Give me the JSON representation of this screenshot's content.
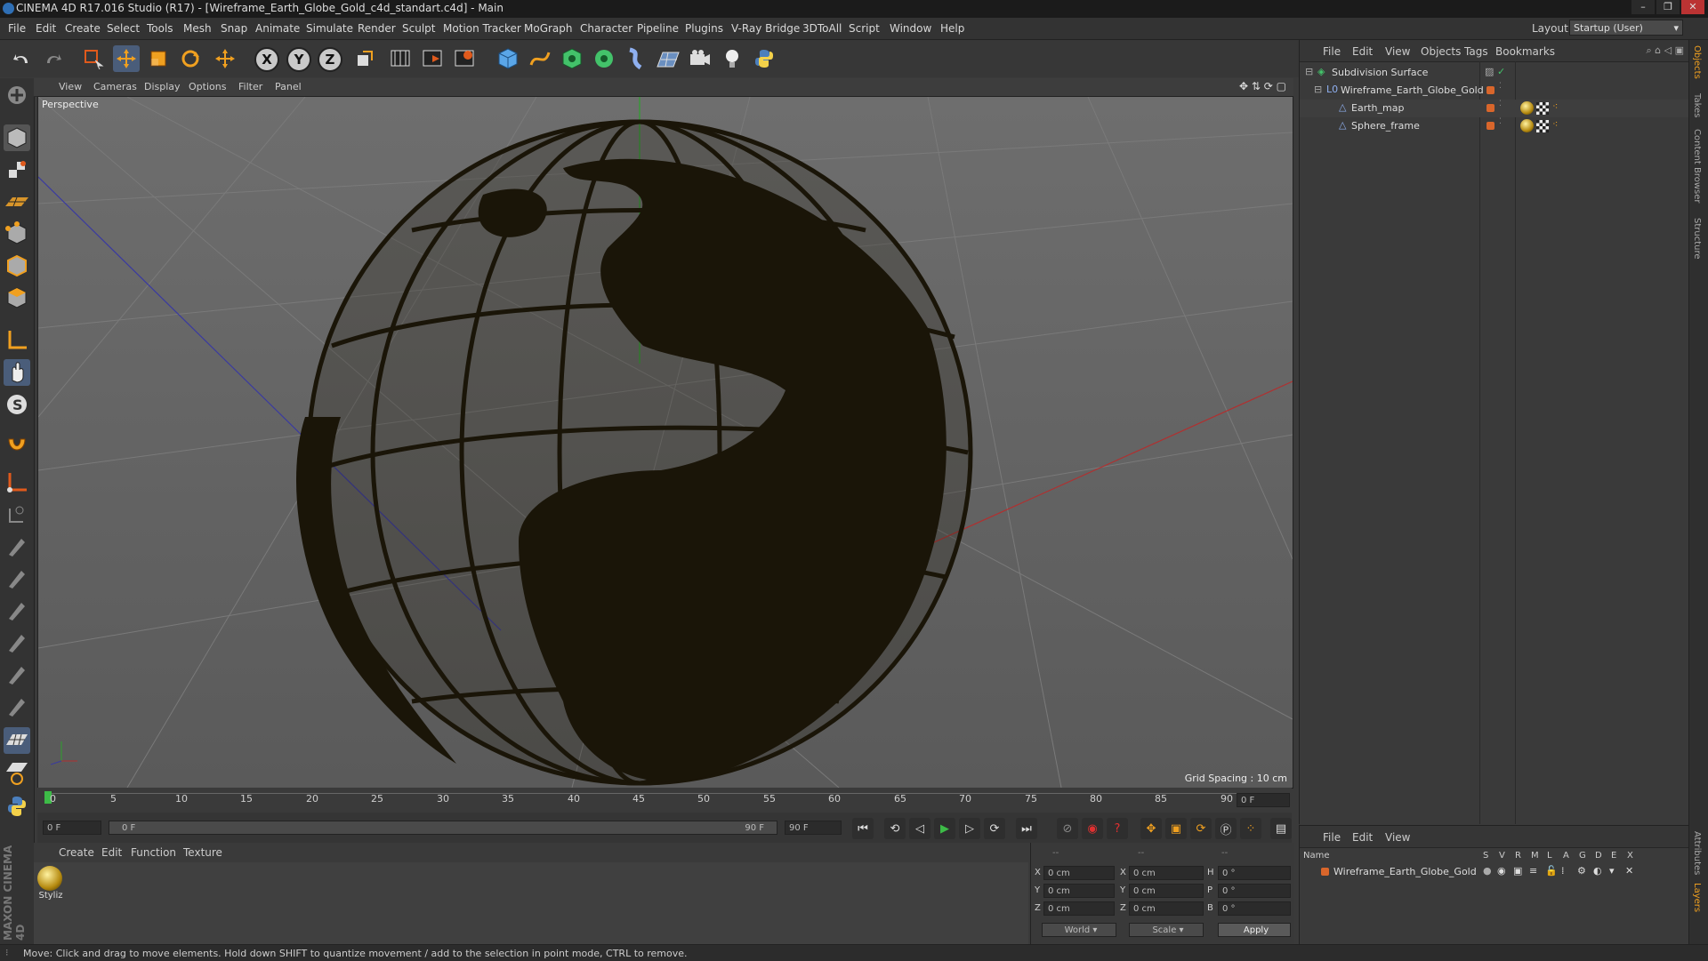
{
  "window": {
    "title": "CINEMA 4D R17.016 Studio (R17) - [Wireframe_Earth_Globe_Gold_c4d_standart.c4d] - Main"
  },
  "menu": [
    "File",
    "Edit",
    "Create",
    "Select",
    "Tools",
    "Mesh",
    "Snap",
    "Animate",
    "Simulate",
    "Render",
    "Sculpt",
    "Motion Tracker",
    "MoGraph",
    "Character",
    "Pipeline",
    "Plugins",
    "V-Ray Bridge",
    "3DToAll",
    "Script",
    "Window",
    "Help"
  ],
  "layout": {
    "label": "Layout:",
    "value": "Startup (User)"
  },
  "toolbar": {
    "axis_x": "X",
    "axis_y": "Y",
    "axis_z": "Z"
  },
  "viewport": {
    "menu": [
      "View",
      "Cameras",
      "Display",
      "Options",
      "Filter",
      "Panel"
    ],
    "label": "Perspective",
    "grid_spacing": "Grid Spacing : 10 cm"
  },
  "timeline": {
    "ticks": [
      "0",
      "5",
      "10",
      "15",
      "20",
      "25",
      "30",
      "35",
      "40",
      "45",
      "50",
      "55",
      "60",
      "65",
      "70",
      "75",
      "80",
      "85",
      "90"
    ],
    "current_frame": "0 F"
  },
  "frame_controls": {
    "start": "0 F",
    "range_start": "0 F",
    "range_end": "90 F",
    "end": "90 F"
  },
  "material_panel": {
    "menu": [
      "Create",
      "Edit",
      "Function",
      "Texture"
    ],
    "material_name": "Styliz"
  },
  "coordinates": {
    "header": [
      "--",
      "--",
      "--"
    ],
    "rows": [
      {
        "a": "X",
        "av": "0 cm",
        "b": "X",
        "bv": "0 cm",
        "c": "H",
        "cv": "0 °"
      },
      {
        "a": "Y",
        "av": "0 cm",
        "b": "Y",
        "bv": "0 cm",
        "c": "P",
        "cv": "0 °"
      },
      {
        "a": "Z",
        "av": "0 cm",
        "b": "Z",
        "bv": "0 cm",
        "c": "B",
        "cv": "0 °"
      }
    ],
    "mode_world": "World",
    "mode_scale": "Scale",
    "apply": "Apply"
  },
  "objects_panel": {
    "menu": [
      "File",
      "Edit",
      "View",
      "Objects",
      "Tags",
      "Bookmarks"
    ],
    "items": [
      {
        "name": "Subdivision Surface",
        "level": 0
      },
      {
        "name": "Wireframe_Earth_Globe_Gold",
        "level": 1
      },
      {
        "name": "Earth_map",
        "level": 2
      },
      {
        "name": "Sphere_frame",
        "level": 2
      }
    ]
  },
  "layers_panel": {
    "menu": [
      "File",
      "Edit",
      "View"
    ],
    "columns": [
      "Name",
      "S",
      "V",
      "R",
      "M",
      "L",
      "A",
      "G",
      "D",
      "E",
      "X"
    ],
    "rows": [
      {
        "name": "Wireframe_Earth_Globe_Gold"
      }
    ]
  },
  "right_tabs": [
    "Objects",
    "Takes",
    "Content Browser",
    "Structure",
    "Attributes",
    "Layers"
  ],
  "status": "Move: Click and drag to move elements. Hold down SHIFT to quantize movement / add to the selection in point mode, CTRL to remove.",
  "logo": "MAXON CINEMA 4D"
}
